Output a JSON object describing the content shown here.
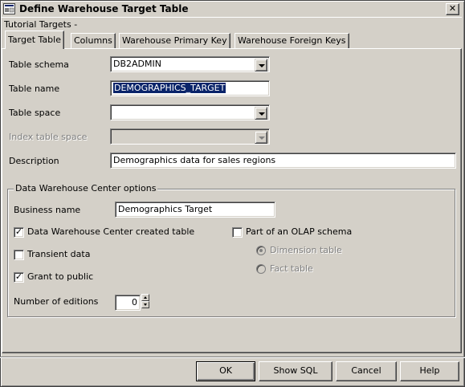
{
  "window": {
    "title": "Define Warehouse Target Table",
    "close_symbol": "✕"
  },
  "subtitle": "Tutorial Targets -",
  "tabs": [
    {
      "label": "Target Table"
    },
    {
      "label": "Columns"
    },
    {
      "label": "Warehouse Primary Key"
    },
    {
      "label": "Warehouse Foreign Keys"
    }
  ],
  "form": {
    "table_schema": {
      "label": "Table schema",
      "value": "DB2ADMIN"
    },
    "table_name": {
      "label": "Table name",
      "value": "DEMOGRAPHICS_TARGET"
    },
    "table_space": {
      "label": "Table space",
      "value": ""
    },
    "index_table_space": {
      "label": "Index table space",
      "value": ""
    },
    "description": {
      "label": "Description",
      "value": "Demographics data for sales regions"
    }
  },
  "options": {
    "group_label": "Data Warehouse Center options",
    "business_name": {
      "label": "Business name",
      "value": "Demographics Target"
    },
    "dwc_created": {
      "label": "Data Warehouse Center created table",
      "checked": true
    },
    "transient": {
      "label": "Transient data",
      "checked": false
    },
    "grant_public": {
      "label": "Grant to public",
      "checked": true
    },
    "olap": {
      "label": "Part of an OLAP schema",
      "checked": false
    },
    "dimension": {
      "label": "Dimension table",
      "selected": true
    },
    "fact": {
      "label": "Fact table",
      "selected": false
    },
    "editions": {
      "label": "Number of editions",
      "value": "0"
    },
    "check_mark": "✓"
  },
  "buttons": {
    "ok": "OK",
    "show_sql": "Show SQL",
    "cancel": "Cancel",
    "help": "Help"
  }
}
